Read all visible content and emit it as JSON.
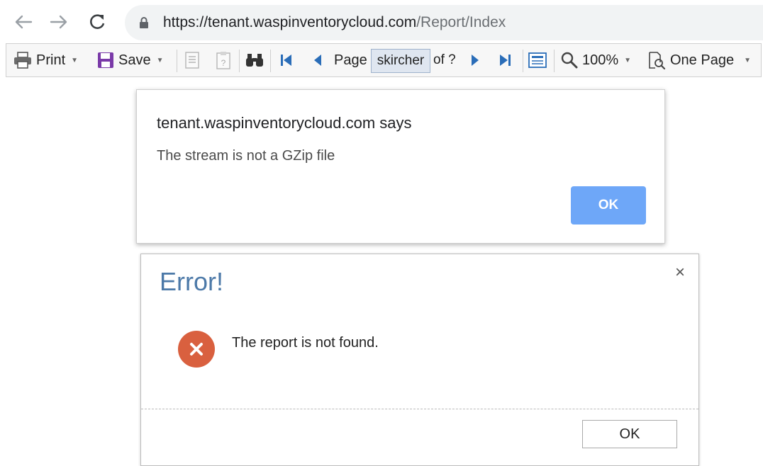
{
  "browser": {
    "url_host": "https://tenant.waspinventorycloud.com",
    "url_path": "/Report/Index"
  },
  "toolbar": {
    "print_label": "Print",
    "save_label": "Save",
    "page_label": "Page",
    "page_value": "skircher",
    "of_label": "of ?",
    "zoom_label": "100%",
    "view_label": "One Page"
  },
  "alert": {
    "title": "tenant.waspinventorycloud.com says",
    "message": "The stream is not a GZip file",
    "ok_label": "OK",
    "ok_color": "#6ea7f8"
  },
  "error_modal": {
    "title": "Error!",
    "message": "The report is not found.",
    "close_label": "×",
    "ok_label": "OK",
    "icon_color": "#d9603f"
  }
}
